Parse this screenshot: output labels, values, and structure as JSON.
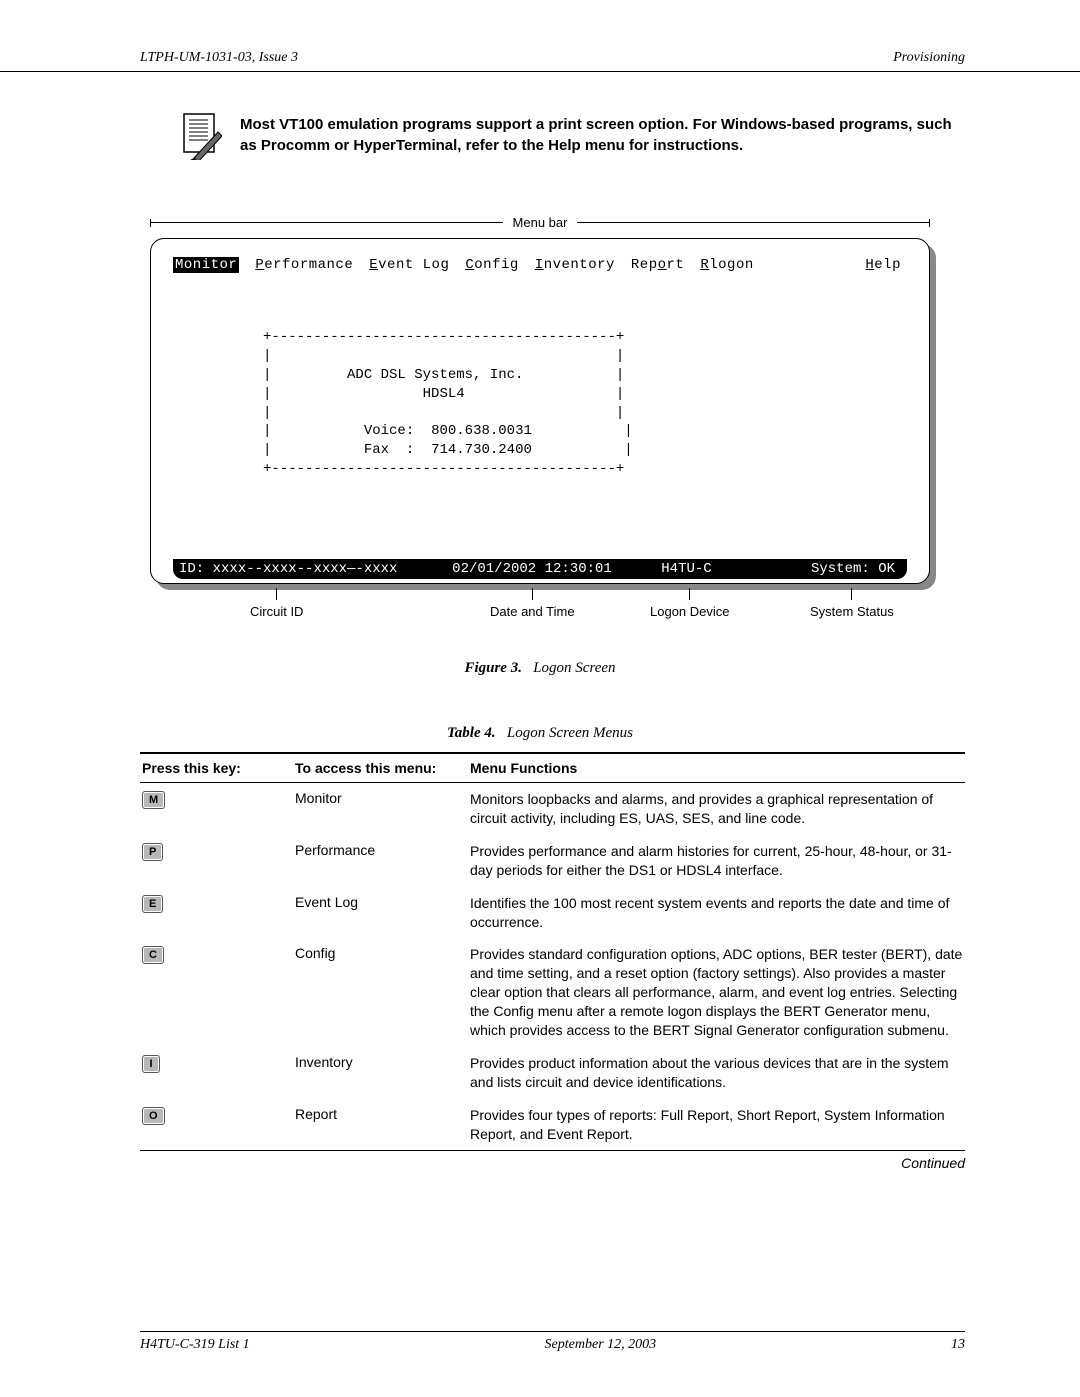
{
  "header": {
    "left": "LTPH-UM-1031-03, Issue 3",
    "right": "Provisioning"
  },
  "note": {
    "text": "Most VT100 emulation programs support a print screen option. For Windows-based programs, such as Procomm or HyperTerminal, refer to the Help menu for instructions."
  },
  "figure": {
    "menu_bar_label": "Menu bar",
    "menus": {
      "monitor": "Monitor",
      "performance": "Performance",
      "eventlog": "Event Log",
      "config": "Config",
      "inventory": "Inventory",
      "report": "Report",
      "rlogon": "Rlogon",
      "help": "Help"
    },
    "box": {
      "company": "ADC DSL Systems, Inc.",
      "product": "HDSL4",
      "voice_label": "Voice:",
      "voice": "800.638.0031",
      "fax_label": "Fax  :",
      "fax": "714.730.2400"
    },
    "status": {
      "id_label": "ID:",
      "id": "xxxx--xxxx--xxxx—-xxxx",
      "datetime": "02/01/2002 12:30:01",
      "device": "H4TU-C",
      "system_label": "System:",
      "system": "OK"
    },
    "callouts": {
      "circuit": "Circuit ID",
      "datetime": "Date and Time",
      "device": "Logon Device",
      "status": "System Status"
    },
    "caption_b": "Figure 3.",
    "caption_t": "Logon Screen"
  },
  "table": {
    "caption_b": "Table 4.",
    "caption_t": "Logon Screen Menus",
    "head": {
      "c1": "Press this key:",
      "c2": "To access this menu:",
      "c3": "Menu Functions"
    },
    "rows": [
      {
        "key": "M",
        "menu": "Monitor",
        "func": "Monitors loopbacks and alarms, and provides a graphical representation of circuit activity, including ES, UAS, SES, and line code."
      },
      {
        "key": "P",
        "menu": "Performance",
        "func": "Provides performance and alarm histories for current, 25-hour, 48-hour, or 31-day periods for either the DS1 or HDSL4 interface."
      },
      {
        "key": "E",
        "menu": "Event Log",
        "func": "Identifies the 100 most recent system events and reports the date and time of occurrence."
      },
      {
        "key": "C",
        "menu": "Config",
        "func": "Provides standard configuration options, ADC options, BER tester (BERT), date and time setting, and a reset option (factory settings). Also provides a master clear option that clears all performance, alarm, and event log entries. Selecting the Config menu after a remote logon displays the BERT Generator menu, which provides access to the BERT Signal Generator configuration submenu."
      },
      {
        "key": "I",
        "menu": "Inventory",
        "func": "Provides product information about the various devices that are in the system and lists circuit and device identifications."
      },
      {
        "key": "O",
        "menu": "Report",
        "func": "Provides four types of reports: Full Report, Short Report, System Information Report, and Event Report."
      }
    ],
    "continued": "Continued"
  },
  "footer": {
    "left": "H4TU-C-319 List 1",
    "center": "September 12, 2003",
    "right": "13"
  }
}
